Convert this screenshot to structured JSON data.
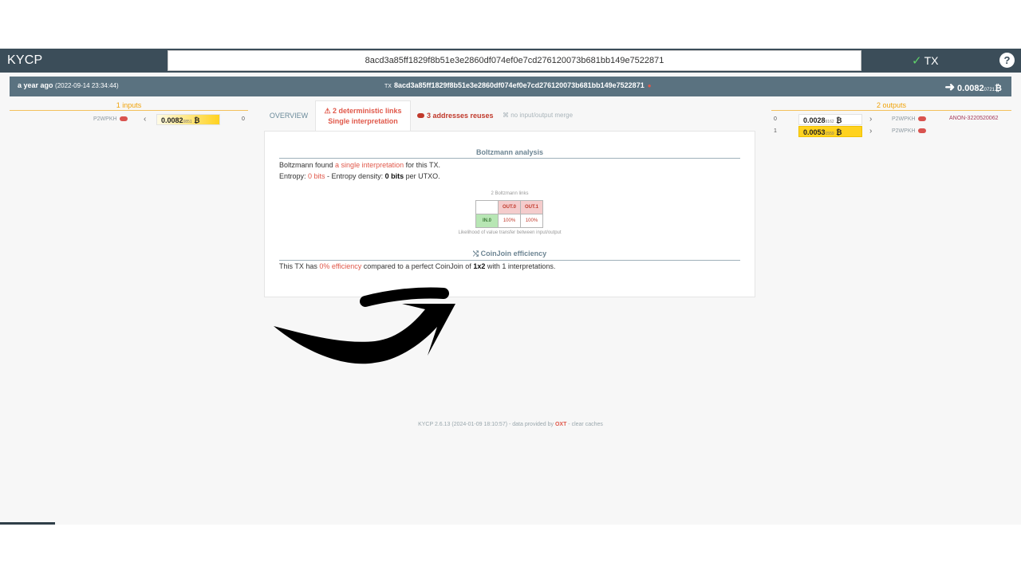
{
  "app": {
    "logo": "KYCP",
    "search_value": "8acd3a85ff1829f8b51e3e2860df074ef0e7cd276120073b681bb149e7522871",
    "mode_label": "TX",
    "help": "?"
  },
  "tx": {
    "age": "a year ago",
    "timestamp": "(2022-09-14 23:34:44)",
    "id_prefix": "TX",
    "id": "8acd3a85ff1829f8b51e3e2860df074ef0e7cd276120073b681bb149e7522871",
    "total_main": "0.0082",
    "total_small": "0721",
    "btc_symbol": "₿"
  },
  "inputs": {
    "header": "1 inputs",
    "items": [
      {
        "type": "P2WPKH",
        "amount_main": "0.0082",
        "amount_small": "0851",
        "index": "0"
      }
    ]
  },
  "outputs": {
    "header": "2 outputs",
    "items": [
      {
        "index": "0",
        "amount_main": "0.0028",
        "amount_small": "9162",
        "type": "P2WPKH",
        "label": "ANON-3220520062"
      },
      {
        "index": "1",
        "amount_main": "0.0053",
        "amount_small": "1559",
        "type": "P2WPKH",
        "label": ""
      }
    ]
  },
  "tabs": {
    "overview": "OVERVIEW",
    "links_line1": "⚠ 2 deterministic links",
    "links_line2": "Single interpretation",
    "reuses": "3 addresses reuses",
    "merge": "no input/output merge"
  },
  "boltzmann": {
    "title": "Boltzmann analysis",
    "line1_pre": "Boltzmann found ",
    "line1_hl": "a single interpretation",
    "line1_post": " for this TX.",
    "line2_pre": "Entropy: ",
    "line2_hl": "0 bits",
    "line2_mid": " - Entropy density: ",
    "line2_bold": "0 bits",
    "line2_post": " per UTXO.",
    "matrix_title": "2 Boltzmann links",
    "matrix_out0": "OUT.0",
    "matrix_out1": "OUT.1",
    "matrix_in0": "IN.0",
    "matrix_v00": "100%",
    "matrix_v01": "100%",
    "matrix_caption": "Likelihood of value transfer between input/output"
  },
  "coinjoin": {
    "title": "⤭ CoinJoin efficiency",
    "pre": "This TX has ",
    "hl": "0% efficiency",
    "mid": " compared to a perfect CoinJoin of ",
    "bold": "1x2",
    "post": " with 1 interpretations."
  },
  "footer": {
    "pre": "KYCP 2.6.13 (2024-01-09 18:10:57) - data provided by ",
    "oxt": "OXT",
    "post": " - clear caches"
  },
  "colors": {
    "topbar": "#3b4d59",
    "txbar": "#5a7280",
    "accent_orange": "#f0a30a",
    "accent_red": "#e0584a",
    "amount_yellow": "#ffd21f"
  }
}
